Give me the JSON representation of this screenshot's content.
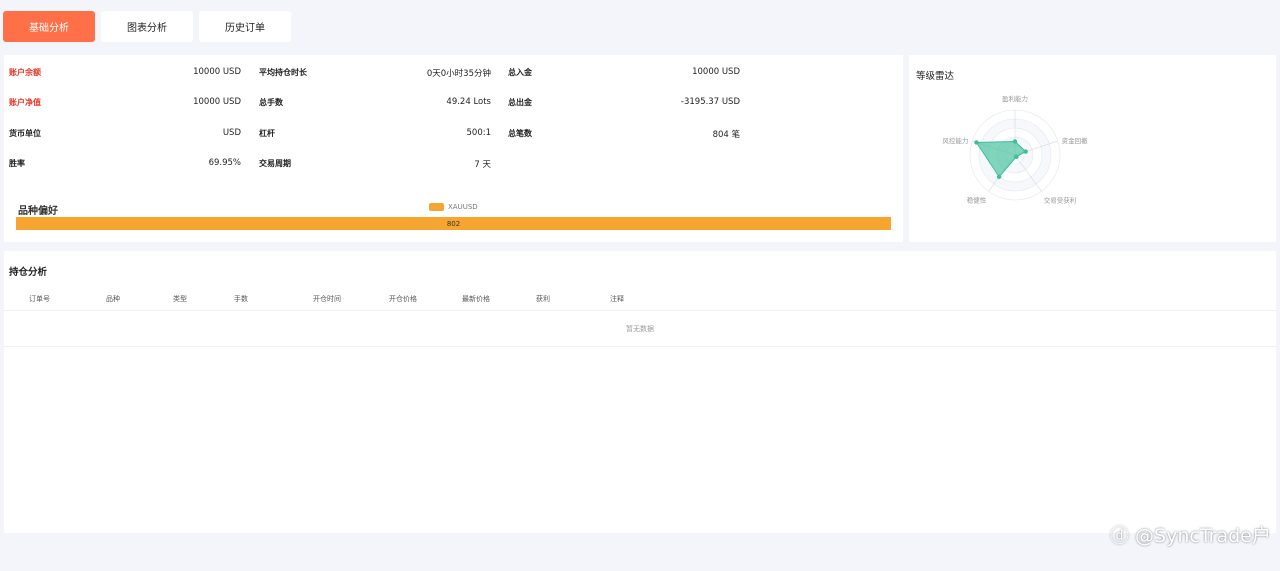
{
  "tabs": [
    {
      "label": "基础分析",
      "active": true
    },
    {
      "label": "图表分析",
      "active": false
    },
    {
      "label": "历史订单",
      "active": false
    }
  ],
  "stats": {
    "balance": {
      "label": "账户余额",
      "value": "10000 USD"
    },
    "equity": {
      "label": "账户净值",
      "value": "10000 USD"
    },
    "currency": {
      "label": "货币单位",
      "value": "USD"
    },
    "winrate": {
      "label": "胜率",
      "value": "69.95%"
    },
    "avg_hold": {
      "label": "平均持仓时长",
      "value": "0天0小时35分钟"
    },
    "total_lots": {
      "label": "总手数",
      "value": "49.24 Lots"
    },
    "leverage": {
      "label": "杠杆",
      "value": "500:1"
    },
    "period": {
      "label": "交易周期",
      "value": "7 天"
    },
    "deposit": {
      "label": "总入金",
      "value": "10000 USD"
    },
    "withdraw": {
      "label": "总出金",
      "value": "-3195.37 USD"
    },
    "trades": {
      "label": "总笔数",
      "value": "804 笔"
    }
  },
  "preference": {
    "title": "品种偏好",
    "legend": "XAUUSD",
    "bar_value": "802",
    "bar_color": "#f5a530"
  },
  "radar": {
    "title": "等级雷达",
    "axes": [
      "盈利能力",
      "资金回撤",
      "交易受获利",
      "稳健性",
      "风控能力"
    ],
    "values": [
      0.3,
      0.25,
      0.05,
      0.6,
      0.9
    ],
    "color": "#3dbf9a"
  },
  "positions": {
    "title": "持仓分析",
    "columns": [
      "订单号",
      "品种",
      "类型",
      "手数",
      "开仓时间",
      "开仓价格",
      "最新价格",
      "获利",
      "注释"
    ],
    "empty_text": "暂无数据"
  },
  "accent_color": "#ff7048",
  "watermark": "ⓓ @SyncTrade户"
}
